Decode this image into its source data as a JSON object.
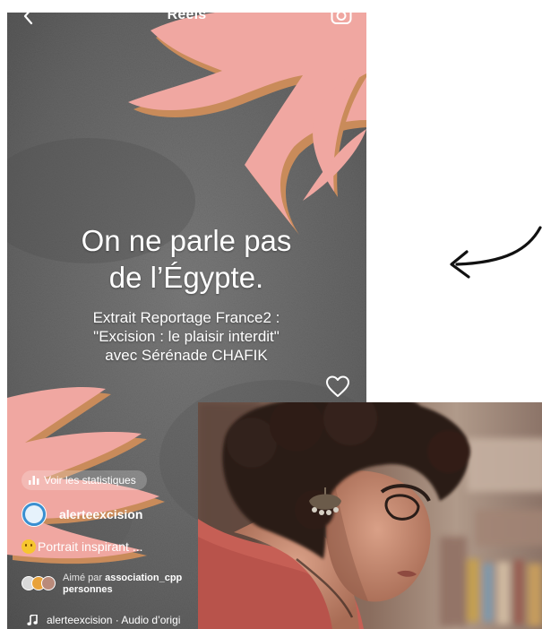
{
  "reel": {
    "header_title": "Reels",
    "headline_line1": "On ne parle pas",
    "headline_line2": "de l’Égypte.",
    "subtitle_line1": "Extrait Reportage France2 :",
    "subtitle_line2": "\"Excision : le plaisir interdit\"",
    "subtitle_line3": "avec Sérénade CHAFIK",
    "stats_label": "Voir les statistiques",
    "account_name": "alerteexcision",
    "caption": "Portrait inspirant ...",
    "liked_prefix": "Aimé par ",
    "liked_user": "association_cpp",
    "liked_suffix": "personnes",
    "audio_label": "alerteexcision · Audio d’origi"
  },
  "colors": {
    "accent_pink": "#f0a7a1",
    "accent_tan": "#c98b5a",
    "background_gray": "#6b6b6b",
    "text": "#ffffff"
  },
  "icons": {
    "back": "chevron-left-icon",
    "camera": "camera-icon",
    "heart": "heart-icon",
    "stats": "bar-chart-icon",
    "music": "music-note-icon",
    "arrow": "curved-arrow-icon"
  }
}
